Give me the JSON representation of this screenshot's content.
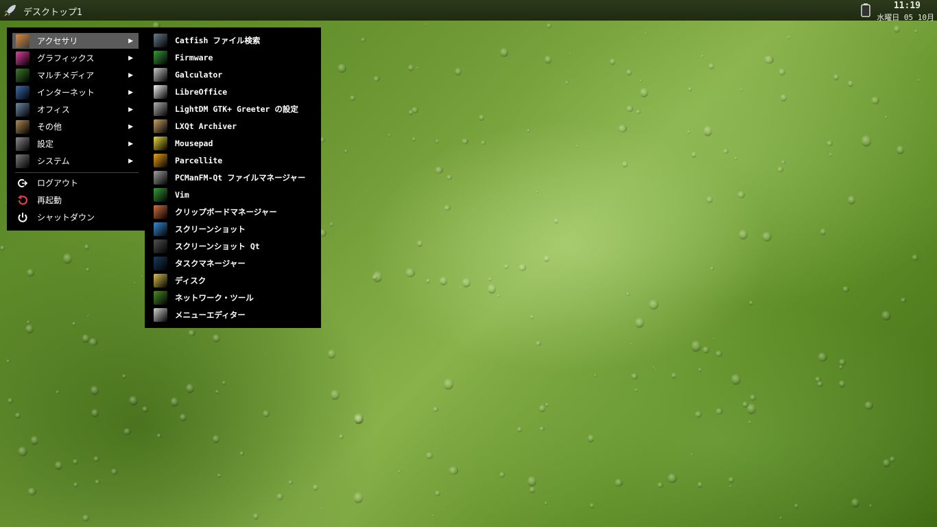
{
  "panel": {
    "desktop_name": "デスクトップ1",
    "time": "11:19",
    "date": "水曜日 05 10月",
    "launcher_icon": "rocket-icon",
    "battery_icon": "battery-icon"
  },
  "main_menu": {
    "categories": [
      {
        "label": "アクセサリ",
        "icon": "accessories-icon",
        "color": "#d98a3a",
        "selected": true
      },
      {
        "label": "グラフィックス",
        "icon": "graphics-icon",
        "color": "#e040a0"
      },
      {
        "label": "マルチメディア",
        "icon": "multimedia-icon",
        "color": "#3c7a2a"
      },
      {
        "label": "インターネット",
        "icon": "internet-icon",
        "color": "#3a6fb0"
      },
      {
        "label": "オフィス",
        "icon": "office-icon",
        "color": "#6a8aa8"
      },
      {
        "label": "その他",
        "icon": "other-icon",
        "color": "#b08a50"
      },
      {
        "label": "設定",
        "icon": "settings-icon",
        "color": "#8a8a8a"
      },
      {
        "label": "システム",
        "icon": "system-icon",
        "color": "#7a7a7a"
      }
    ],
    "actions": [
      {
        "label": "ログアウト",
        "icon": "logout-icon"
      },
      {
        "label": "再起動",
        "icon": "reboot-icon"
      },
      {
        "label": "シャットダウン",
        "icon": "shutdown-icon"
      }
    ]
  },
  "sub_menu": {
    "items": [
      {
        "label": "Catfish ファイル検索",
        "icon": "catfish-icon",
        "color": "#6a7a8a"
      },
      {
        "label": "Firmware",
        "icon": "firmware-icon",
        "color": "#3a9a3a"
      },
      {
        "label": "Galculator",
        "icon": "calculator-icon",
        "color": "#c8c8c8"
      },
      {
        "label": "LibreOffice",
        "icon": "libreoffice-icon",
        "color": "#f0f0f0"
      },
      {
        "label": "LightDM GTK+ Greeter の設定",
        "icon": "lightdm-icon",
        "color": "#b0b0b0"
      },
      {
        "label": "LXQt Archiver",
        "icon": "archiver-icon",
        "color": "#c8a068"
      },
      {
        "label": "Mousepad",
        "icon": "mousepad-icon",
        "color": "#e8d840"
      },
      {
        "label": "Parcellite",
        "icon": "parcellite-icon",
        "color": "#e8a020"
      },
      {
        "label": "PCManFM-Qt ファイルマネージャー",
        "icon": "file-manager-icon",
        "color": "#a0a0a0"
      },
      {
        "label": "Vim",
        "icon": "vim-icon",
        "color": "#3a9a3a"
      },
      {
        "label": "クリップボードマネージャー",
        "icon": "clipboard-icon",
        "color": "#d07040"
      },
      {
        "label": "スクリーンショット",
        "icon": "screenshot-icon",
        "color": "#3a8ad0"
      },
      {
        "label": "スクリーンショット Qt",
        "icon": "screenshot-qt-icon",
        "color": "#505050"
      },
      {
        "label": "タスクマネージャー",
        "icon": "task-manager-icon",
        "color": "#1a3a5a"
      },
      {
        "label": "ディスク",
        "icon": "disk-icon",
        "color": "#d8c050"
      },
      {
        "label": "ネットワーク・ツール",
        "icon": "network-tools-icon",
        "color": "#4a8a2a"
      },
      {
        "label": "メニューエディター",
        "icon": "menu-editor-icon",
        "color": "#d0d0d0"
      }
    ]
  }
}
